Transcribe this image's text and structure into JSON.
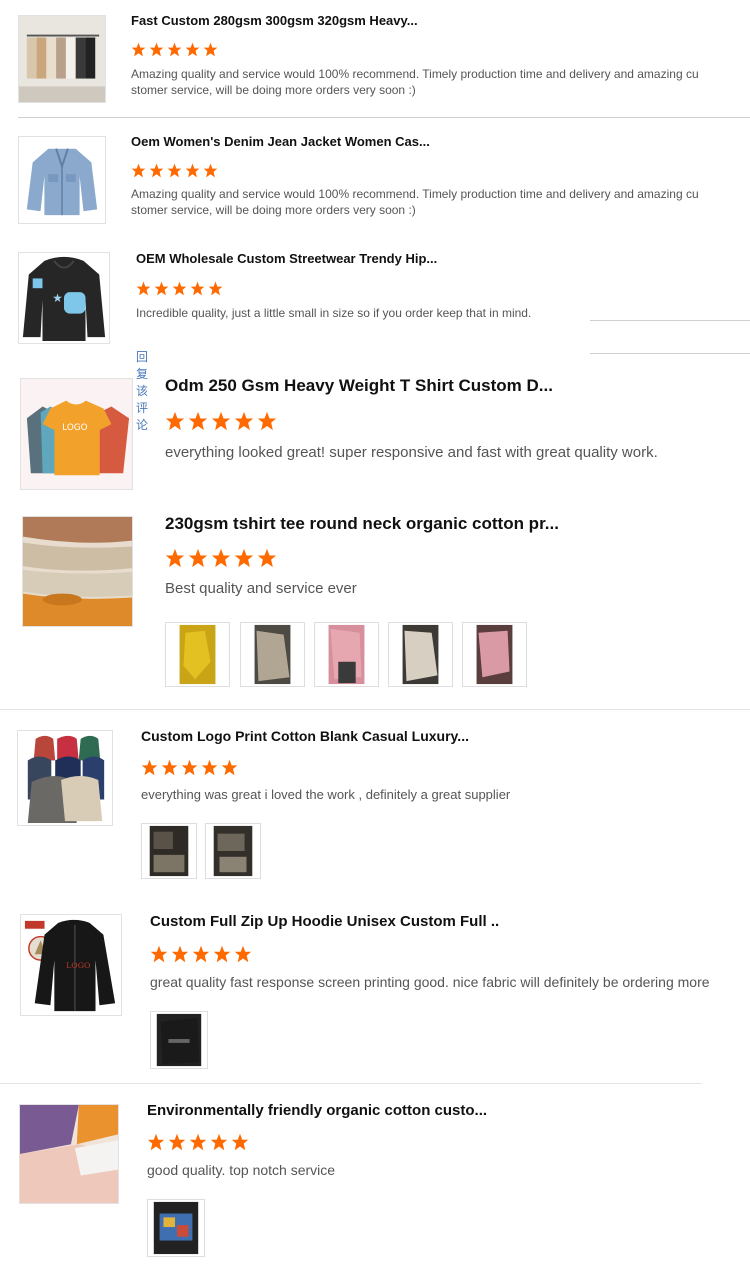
{
  "accent": "#ff6a00",
  "reviews": [
    {
      "title": "Fast Custom 280gsm 300gsm 320gsm Heavy...",
      "rating": 5,
      "text": "Amazing quality and service would 100% recommend. Timely production time and delivery and amazing cu stomer service, will be doing more orders very soon :)",
      "thumb": "tshirts-on-hangers"
    },
    {
      "title": "Oem Women's Denim Jean Jacket Women Cas...",
      "rating": 5,
      "text": "Amazing quality and service would 100% recommend. Timely production time and delivery and amazing cu stomer service, will be doing more orders very soon :)",
      "thumb": "denim-jacket"
    },
    {
      "title": "OEM Wholesale Custom Streetwear Trendy Hip...",
      "rating": 5,
      "text": "Incredible quality, just a little small in size so if you order keep that in mind.",
      "reply_link": "回复该评论",
      "thumb": "black-hoodie"
    },
    {
      "title": "Odm 250 Gsm Heavy Weight T Shirt Custom D...",
      "rating": 5,
      "text": "everything looked great! super responsive and fast with great quality work.",
      "thumb": "colored-tshirts",
      "thumb_text": "LOGO"
    },
    {
      "title": "230gsm tshirt tee round neck organic cotton pr...",
      "rating": 5,
      "text": "Best quality and service ever",
      "thumb": "folded-tees"
    },
    {
      "title": "Custom Logo Print Cotton Blank Casual Luxury...",
      "rating": 5,
      "text": "everything was great i loved the work , definitely a great supplier",
      "thumb": "hoodie-collection"
    },
    {
      "title": "Custom Full Zip Up Hoodie Unisex Custom Full ...",
      "rating": 5,
      "text": "great quality fast response screen printing good. nice fabric will definitely be ordering more",
      "thumb": "zip-hoodie",
      "thumb_text": "LOGO"
    },
    {
      "title": "Environmentally friendly organic cotton custo...",
      "rating": 5,
      "text": "good quality. top notch service",
      "thumb": "pastel-tees"
    }
  ]
}
